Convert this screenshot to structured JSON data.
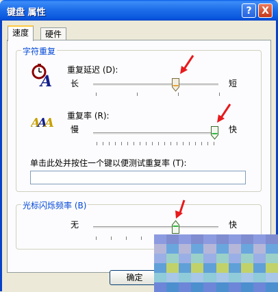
{
  "window": {
    "title": "键盘 属性",
    "help_label": "?",
    "close_label": "X"
  },
  "tabs": [
    {
      "label": "速度",
      "selected": true
    },
    {
      "label": "硬件",
      "selected": false
    }
  ],
  "char_repeat": {
    "group_title": "字符重复",
    "delay": {
      "label": "重复延迟 (D):",
      "min_label": "长",
      "max_label": "短",
      "value_fraction": 0.67
    },
    "rate": {
      "label": "重复率 (R):",
      "min_label": "慢",
      "max_label": "快",
      "value_fraction": 1.0
    },
    "test": {
      "label": "单击此处并按住一个键以便测试重复率 (T):",
      "value": ""
    }
  },
  "cursor_blink": {
    "group_title": "光标闪烁频率 (B)",
    "min_label": "无",
    "max_label": "快",
    "value_fraction": 0.67
  },
  "buttons": {
    "ok_label": "确定"
  },
  "colors": {
    "titlebar": "#0A5FE8",
    "group_title": "#0046D5",
    "annotation_arrow": "#E8191C"
  }
}
